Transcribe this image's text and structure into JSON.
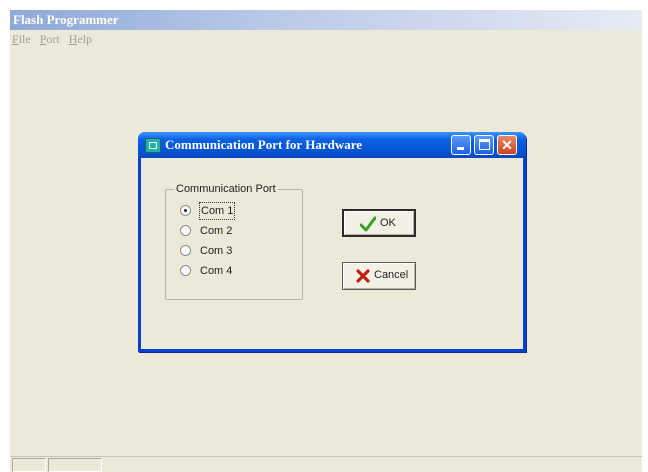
{
  "app": {
    "title": "Flash Programmer",
    "menu": [
      {
        "key": "F",
        "rest": "ile"
      },
      {
        "key": "P",
        "rest": "ort"
      },
      {
        "key": "H",
        "rest": "elp"
      }
    ]
  },
  "dialog": {
    "title": "Communication Port for Hardware",
    "group_label": "Communication Port",
    "ports": [
      {
        "label": "Com 1",
        "selected": true
      },
      {
        "label": "Com 2",
        "selected": false
      },
      {
        "label": "Com 3",
        "selected": false
      },
      {
        "label": "Com 4",
        "selected": false
      }
    ],
    "ok_label": "OK",
    "cancel_label": "Cancel"
  },
  "colors": {
    "dialog_accent": "#0a3fd4",
    "ok_check": "#3aa020",
    "cancel_x": "#c41e12"
  },
  "icons": {
    "app_dialog_icon": "port-icon",
    "ok": "checkmark-icon",
    "cancel": "x-icon"
  }
}
